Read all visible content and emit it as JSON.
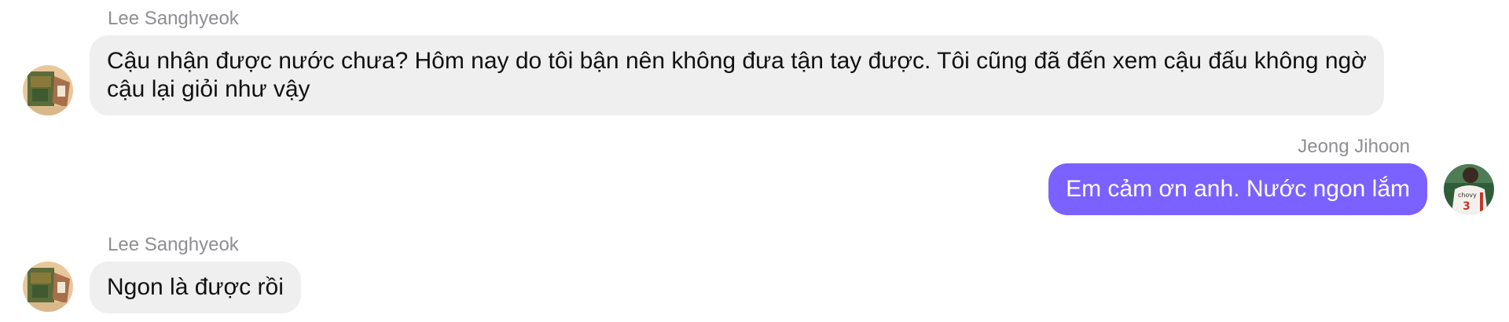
{
  "messages": [
    {
      "sender": "Lee Sanghyeok",
      "text": "Cậu nhận được nước chưa? Hôm nay do tôi bận nên không đưa tận tay được. Tôi cũng đã đến xem cậu đấu không ngờ cậu lại giỏi như vậy",
      "direction": "incoming"
    },
    {
      "sender": "Jeong Jihoon",
      "text": "Em cảm ơn anh. Nước ngon lắm",
      "direction": "outgoing"
    },
    {
      "sender": "Lee Sanghyeok",
      "text": "Ngon là được rồi",
      "direction": "incoming"
    }
  ],
  "colors": {
    "outgoing_bubble": "#7b61ff",
    "incoming_bubble": "#efeff0",
    "sender_name": "#8e8e93"
  },
  "icons": {
    "incoming_avatar": "avatar-photo-icon",
    "outgoing_avatar": "avatar-photo-icon"
  }
}
